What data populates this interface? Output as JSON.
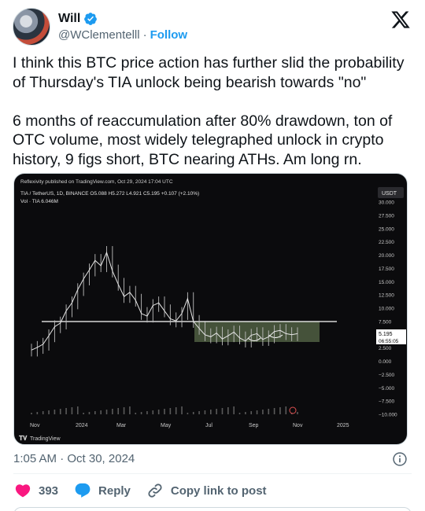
{
  "author": {
    "name": "Will",
    "handle": "@WClementelll",
    "separator": "·",
    "follow_label": "Follow"
  },
  "tweet": {
    "paragraphs": [
      "I think this BTC price action has further slid the probability of Thursday's TIA unlock being bearish towards \"no\"",
      "6 months of reaccumulation after 80% drawdown, ton of OTC volume, most widely telegraphed unlock in crypto history, 9 figs short, BTC nearing ATHs. Am long rn."
    ],
    "timestamp": "1:05 AM · Oct 30, 2024"
  },
  "actions": {
    "like_count": "393",
    "reply_label": "Reply",
    "copy_label": "Copy link to post"
  },
  "chart": {
    "published": "Reflexivity published on TradingView.com, Oct 29, 2024 17:04 UTC",
    "ticker_line": "TIA / TetherUS, 1D, BINANCE  O5.088  H5.272  L4.921  C5.195  +0.107 (+2.10%)",
    "vol_line": "Vol · TIA  6.046M",
    "currency": "USDT",
    "price_label": "5.195",
    "countdown": "06:55:05",
    "brand": "TradingView",
    "colors": {
      "background": "#0b0b0d",
      "candle": "#d7d7d7",
      "line": "#ffffff",
      "zone": "#5a6b4a",
      "price_tag": "#ffffff"
    }
  },
  "chart_data": {
    "type": "line",
    "title": "TIA / TetherUS, 1D, BINANCE",
    "x": [
      "Nov",
      "2024",
      "Mar",
      "May",
      "Jul",
      "Sep",
      "Nov",
      "2025"
    ],
    "y_ticks": [
      "30.000",
      "27.500",
      "25.000",
      "22.500",
      "20.000",
      "17.500",
      "15.000",
      "12.500",
      "10.000",
      "7.500",
      "5.000",
      "2.500",
      "0.000",
      "−2.500",
      "−5.000",
      "−7.500",
      "−10.000"
    ],
    "series": [
      {
        "values": [
          2.1,
          2.6,
          3.2,
          4.8,
          6.5,
          7.2,
          9.5,
          11.0,
          13.5,
          15.5,
          17.2,
          19.0,
          18.0,
          20.5,
          17.0,
          14.5,
          12.2,
          13.0,
          11.5,
          9.0,
          8.5,
          10.5,
          11.0,
          9.5,
          8.0,
          7.6,
          9.0,
          11.8,
          7.5,
          6.2,
          5.0,
          4.6,
          5.3,
          4.2,
          4.8,
          5.5,
          4.4,
          3.8,
          4.9,
          5.2,
          4.1,
          4.6,
          5.6,
          5.8,
          5.2,
          5.0,
          5.195
        ]
      }
    ],
    "annotations": {
      "horizontal_level": 7.5,
      "accumulation_zone": [
        3.2,
        7.5
      ],
      "last_price": 5.195
    },
    "ylim": [
      -10,
      30
    ],
    "grid": false
  }
}
